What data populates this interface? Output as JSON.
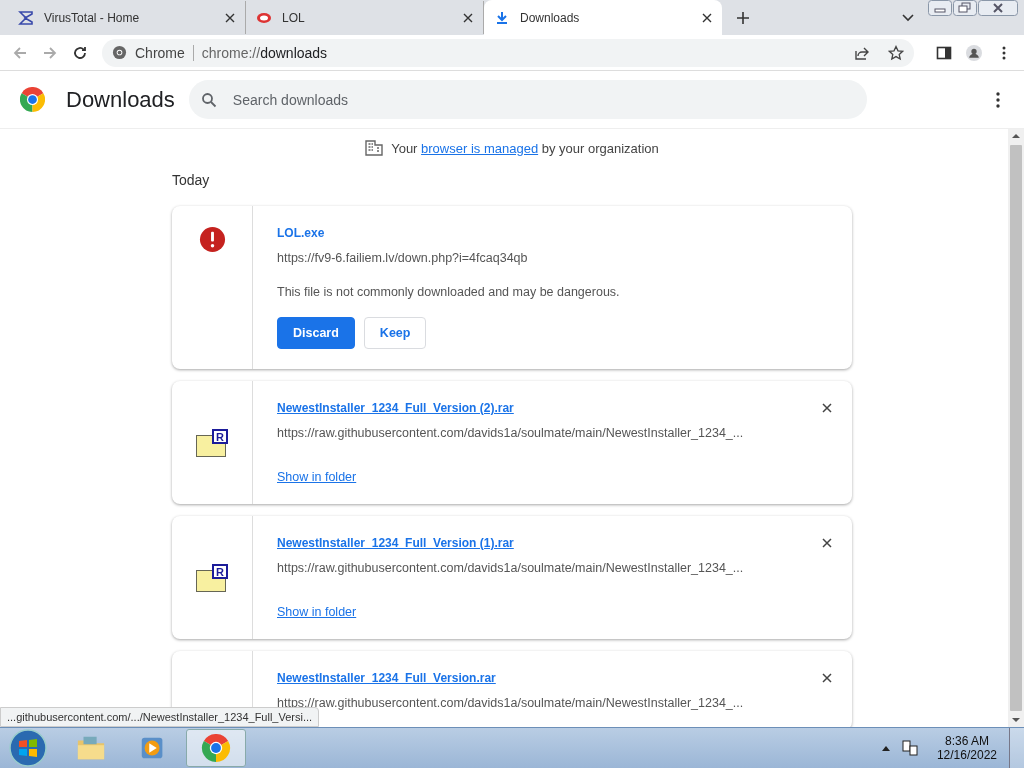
{
  "tabs": [
    {
      "title": "VirusTotal - Home",
      "selected": false
    },
    {
      "title": "LOL",
      "selected": false
    },
    {
      "title": "Downloads",
      "selected": true
    }
  ],
  "address_bar": {
    "site_label": "Chrome",
    "url_scheme": "chrome://",
    "url_host": "downloads"
  },
  "page": {
    "title": "Downloads",
    "search": {
      "placeholder": "Search downloads"
    },
    "managed_notice": {
      "before": "Your ",
      "link": "browser is managed",
      "after": " by your organization"
    },
    "section": "Today",
    "downloads": [
      {
        "kind": "dangerous",
        "name": "LOL.exe",
        "url": "https://fv9-6.failiem.lv/down.php?i=4fcaq34qb",
        "warning": "This file is not commonly downloaded and may be dangerous.",
        "buttons": [
          "Discard",
          "Keep"
        ]
      },
      {
        "kind": "complete",
        "name": "NewestInstaller_1234_Full_Version (2).rar",
        "url": "https://raw.githubusercontent.com/davids1a/soulmate/main/NewestInstaller_1234_...",
        "icon_letter": "R",
        "action": "Show in folder"
      },
      {
        "kind": "complete",
        "name": "NewestInstaller_1234_Full_Version (1).rar",
        "url": "https://raw.githubusercontent.com/davids1a/soulmate/main/NewestInstaller_1234_...",
        "icon_letter": "R",
        "action": "Show in folder"
      },
      {
        "kind": "complete",
        "name": "NewestInstaller_1234_Full_Version.rar",
        "url": "https://raw.githubusercontent.com/davids1a/soulmate/main/NewestInstaller_1234_..."
      }
    ],
    "status_tooltip": "...githubusercontent.com/.../NewestInstaller_1234_Full_Versi..."
  },
  "taskbar": {
    "apps": [
      {
        "selected": false
      },
      {
        "selected": false
      },
      {
        "selected": true
      }
    ],
    "time": "8:36 AM",
    "date": "12/16/2022"
  }
}
